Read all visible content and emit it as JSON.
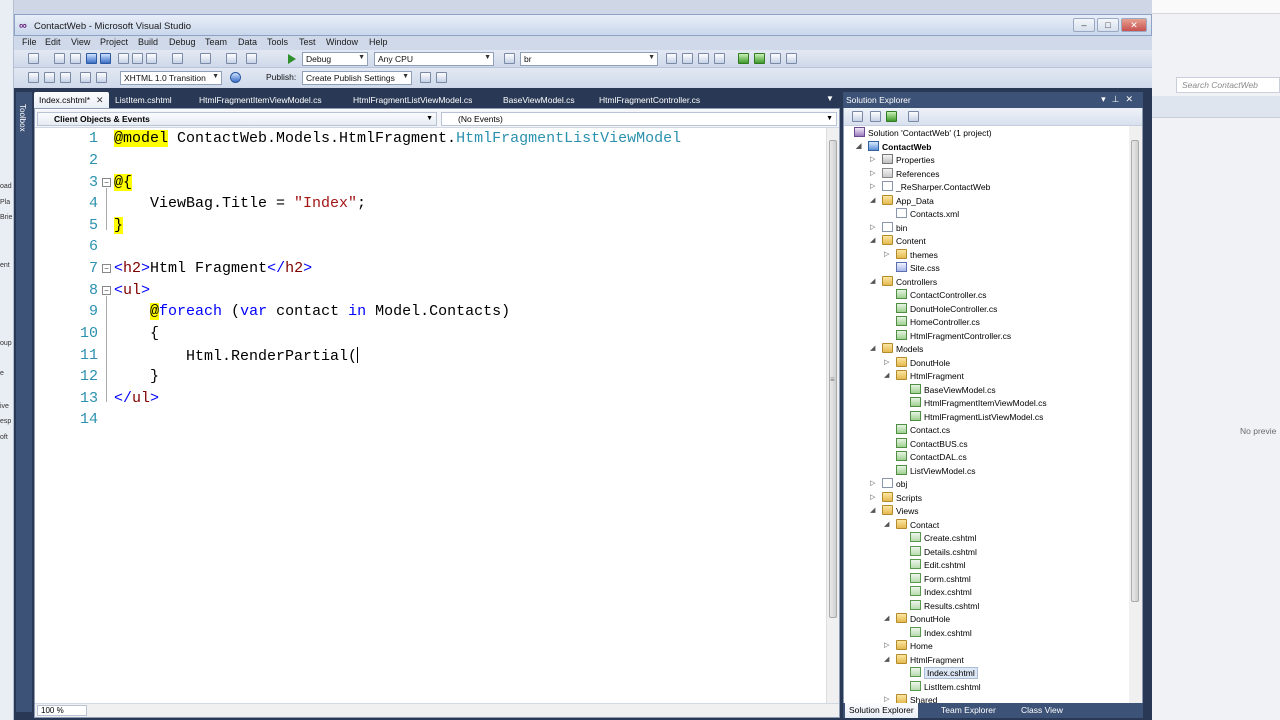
{
  "window": {
    "title": "ContactWeb - Microsoft Visual Studio"
  },
  "menu": [
    "File",
    "Edit",
    "View",
    "Project",
    "Build",
    "Debug",
    "Team",
    "Data",
    "Tools",
    "Test",
    "Window",
    "Help"
  ],
  "toolbar": {
    "config": "Debug",
    "platform": "Any CPU",
    "find": "br",
    "doctype": "XHTML 1.0 Transition",
    "publish_label": "Publish:",
    "publish_value": "Create Publish Settings"
  },
  "toolbox_label": "Toolbox",
  "tabs": [
    {
      "label": "Index.cshtml*",
      "active": true
    },
    {
      "label": "ListItem.cshtml"
    },
    {
      "label": "HtmlFragmentItemViewModel.cs"
    },
    {
      "label": "HtmlFragmentListViewModel.cs"
    },
    {
      "label": "BaseViewModel.cs"
    },
    {
      "label": "HtmlFragmentController.cs"
    }
  ],
  "navbar": {
    "left": "Client Objects & Events",
    "right": "(No Events)"
  },
  "code": {
    "line_numbers": [
      "1",
      "2",
      "3",
      "4",
      "5",
      "6",
      "7",
      "8",
      "9",
      "10",
      "11",
      "12",
      "13",
      "14"
    ],
    "l1a": "@model",
    "l1b": " ContactWeb.Models.HtmlFragment.",
    "l1c": "HtmlFragmentListViewModel",
    "l3a": "@{",
    "l4a": "    ViewBag.Title = ",
    "l4b": "\"Index\"",
    "l4c": ";",
    "l5a": "}",
    "l7a": "<",
    "l7b": "h2",
    "l7c": ">",
    "l7d": "Html Fragment",
    "l7e": "</",
    "l7f": "h2",
    "l7g": ">",
    "l8a": "<",
    "l8b": "ul",
    "l8c": ">",
    "l9a": "    ",
    "l9b": "@",
    "l9c": "foreach",
    "l9d": " (",
    "l9e": "var",
    "l9f": " contact ",
    "l9g": "in",
    "l9h": " Model.Contacts)",
    "l10a": "    {",
    "l11a": "        Html.RenderPartial(",
    "l12a": "    }",
    "l13a": "</",
    "l13b": "ul",
    "l13c": ">"
  },
  "zoom": "100 %",
  "solution_explorer": {
    "title": "Solution Explorer",
    "nodes": [
      "Solution 'ContactWeb' (1 project)",
      "ContactWeb",
      "Properties",
      "References",
      "_ReSharper.ContactWeb",
      "App_Data",
      "Contacts.xml",
      "bin",
      "Content",
      "themes",
      "Site.css",
      "Controllers",
      "ContactController.cs",
      "DonutHoleController.cs",
      "HomeController.cs",
      "HtmlFragmentController.cs",
      "Models",
      "DonutHole",
      "HtmlFragment",
      "BaseViewModel.cs",
      "HtmlFragmentItemViewModel.cs",
      "HtmlFragmentListViewModel.cs",
      "Contact.cs",
      "ContactBUS.cs",
      "ContactDAL.cs",
      "ListViewModel.cs",
      "obj",
      "Scripts",
      "Views",
      "Contact",
      "Create.cshtml",
      "Details.cshtml",
      "Edit.cshtml",
      "Form.cshtml",
      "Index.cshtml",
      "Results.cshtml",
      "DonutHole",
      "Index.cshtml",
      "Home",
      "HtmlFragment",
      "Index.cshtml",
      "ListItem.cshtml",
      "Shared"
    ],
    "bottom_tabs": [
      "Solution Explorer",
      "Team Explorer",
      "Class View"
    ]
  },
  "background_app": {
    "search_placeholder": "Search ContactWeb",
    "no_preview": "No previe",
    "left_fragments": [
      "oad",
      "Pla",
      "Brie",
      "ent",
      "oup",
      "e",
      "ive",
      "esp",
      "oft"
    ]
  }
}
